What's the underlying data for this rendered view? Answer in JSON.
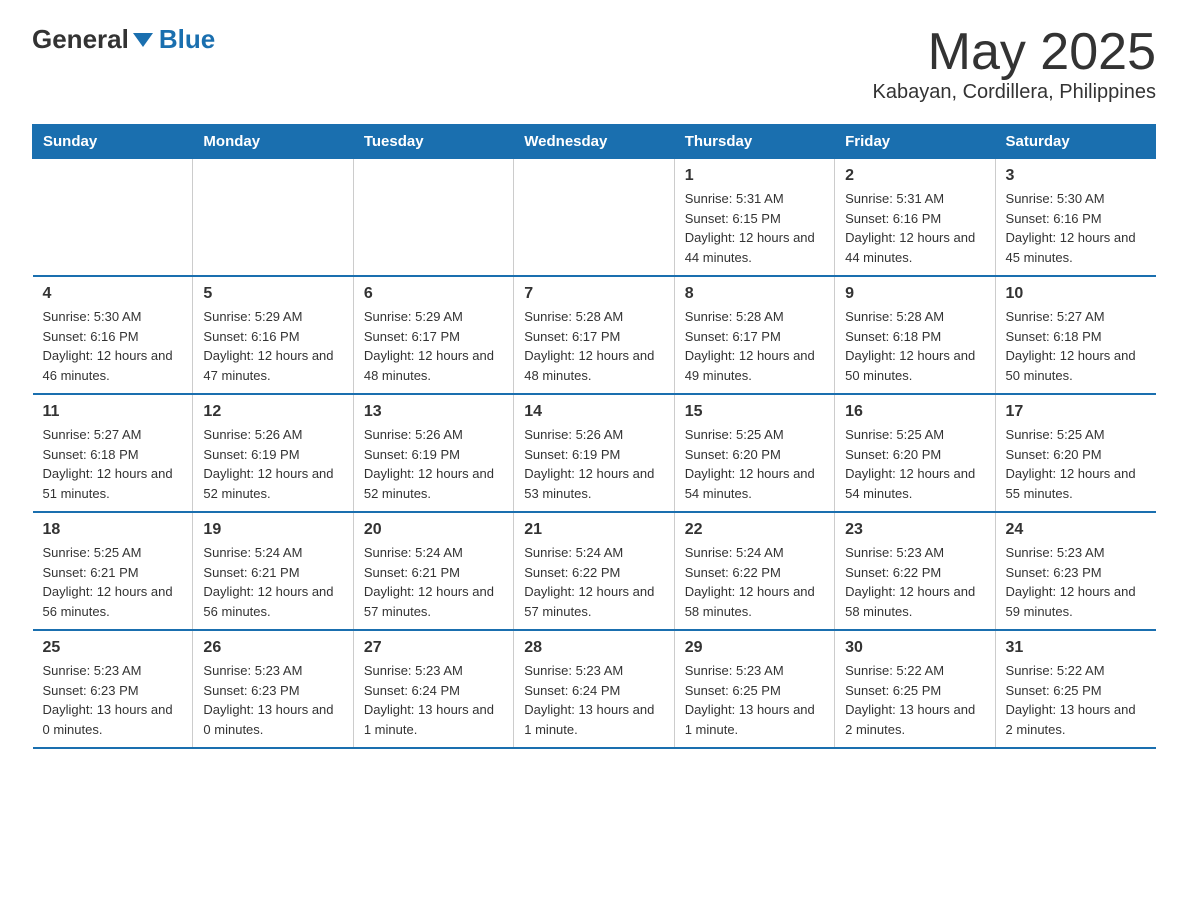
{
  "logo": {
    "general": "General",
    "blue": "Blue"
  },
  "header": {
    "month": "May 2025",
    "location": "Kabayan, Cordillera, Philippines"
  },
  "days_header": [
    "Sunday",
    "Monday",
    "Tuesday",
    "Wednesday",
    "Thursday",
    "Friday",
    "Saturday"
  ],
  "weeks": [
    [
      {
        "day": "",
        "info": ""
      },
      {
        "day": "",
        "info": ""
      },
      {
        "day": "",
        "info": ""
      },
      {
        "day": "",
        "info": ""
      },
      {
        "day": "1",
        "info": "Sunrise: 5:31 AM\nSunset: 6:15 PM\nDaylight: 12 hours and 44 minutes."
      },
      {
        "day": "2",
        "info": "Sunrise: 5:31 AM\nSunset: 6:16 PM\nDaylight: 12 hours and 44 minutes."
      },
      {
        "day": "3",
        "info": "Sunrise: 5:30 AM\nSunset: 6:16 PM\nDaylight: 12 hours and 45 minutes."
      }
    ],
    [
      {
        "day": "4",
        "info": "Sunrise: 5:30 AM\nSunset: 6:16 PM\nDaylight: 12 hours and 46 minutes."
      },
      {
        "day": "5",
        "info": "Sunrise: 5:29 AM\nSunset: 6:16 PM\nDaylight: 12 hours and 47 minutes."
      },
      {
        "day": "6",
        "info": "Sunrise: 5:29 AM\nSunset: 6:17 PM\nDaylight: 12 hours and 48 minutes."
      },
      {
        "day": "7",
        "info": "Sunrise: 5:28 AM\nSunset: 6:17 PM\nDaylight: 12 hours and 48 minutes."
      },
      {
        "day": "8",
        "info": "Sunrise: 5:28 AM\nSunset: 6:17 PM\nDaylight: 12 hours and 49 minutes."
      },
      {
        "day": "9",
        "info": "Sunrise: 5:28 AM\nSunset: 6:18 PM\nDaylight: 12 hours and 50 minutes."
      },
      {
        "day": "10",
        "info": "Sunrise: 5:27 AM\nSunset: 6:18 PM\nDaylight: 12 hours and 50 minutes."
      }
    ],
    [
      {
        "day": "11",
        "info": "Sunrise: 5:27 AM\nSunset: 6:18 PM\nDaylight: 12 hours and 51 minutes."
      },
      {
        "day": "12",
        "info": "Sunrise: 5:26 AM\nSunset: 6:19 PM\nDaylight: 12 hours and 52 minutes."
      },
      {
        "day": "13",
        "info": "Sunrise: 5:26 AM\nSunset: 6:19 PM\nDaylight: 12 hours and 52 minutes."
      },
      {
        "day": "14",
        "info": "Sunrise: 5:26 AM\nSunset: 6:19 PM\nDaylight: 12 hours and 53 minutes."
      },
      {
        "day": "15",
        "info": "Sunrise: 5:25 AM\nSunset: 6:20 PM\nDaylight: 12 hours and 54 minutes."
      },
      {
        "day": "16",
        "info": "Sunrise: 5:25 AM\nSunset: 6:20 PM\nDaylight: 12 hours and 54 minutes."
      },
      {
        "day": "17",
        "info": "Sunrise: 5:25 AM\nSunset: 6:20 PM\nDaylight: 12 hours and 55 minutes."
      }
    ],
    [
      {
        "day": "18",
        "info": "Sunrise: 5:25 AM\nSunset: 6:21 PM\nDaylight: 12 hours and 56 minutes."
      },
      {
        "day": "19",
        "info": "Sunrise: 5:24 AM\nSunset: 6:21 PM\nDaylight: 12 hours and 56 minutes."
      },
      {
        "day": "20",
        "info": "Sunrise: 5:24 AM\nSunset: 6:21 PM\nDaylight: 12 hours and 57 minutes."
      },
      {
        "day": "21",
        "info": "Sunrise: 5:24 AM\nSunset: 6:22 PM\nDaylight: 12 hours and 57 minutes."
      },
      {
        "day": "22",
        "info": "Sunrise: 5:24 AM\nSunset: 6:22 PM\nDaylight: 12 hours and 58 minutes."
      },
      {
        "day": "23",
        "info": "Sunrise: 5:23 AM\nSunset: 6:22 PM\nDaylight: 12 hours and 58 minutes."
      },
      {
        "day": "24",
        "info": "Sunrise: 5:23 AM\nSunset: 6:23 PM\nDaylight: 12 hours and 59 minutes."
      }
    ],
    [
      {
        "day": "25",
        "info": "Sunrise: 5:23 AM\nSunset: 6:23 PM\nDaylight: 13 hours and 0 minutes."
      },
      {
        "day": "26",
        "info": "Sunrise: 5:23 AM\nSunset: 6:23 PM\nDaylight: 13 hours and 0 minutes."
      },
      {
        "day": "27",
        "info": "Sunrise: 5:23 AM\nSunset: 6:24 PM\nDaylight: 13 hours and 1 minute."
      },
      {
        "day": "28",
        "info": "Sunrise: 5:23 AM\nSunset: 6:24 PM\nDaylight: 13 hours and 1 minute."
      },
      {
        "day": "29",
        "info": "Sunrise: 5:23 AM\nSunset: 6:25 PM\nDaylight: 13 hours and 1 minute."
      },
      {
        "day": "30",
        "info": "Sunrise: 5:22 AM\nSunset: 6:25 PM\nDaylight: 13 hours and 2 minutes."
      },
      {
        "day": "31",
        "info": "Sunrise: 5:22 AM\nSunset: 6:25 PM\nDaylight: 13 hours and 2 minutes."
      }
    ]
  ]
}
